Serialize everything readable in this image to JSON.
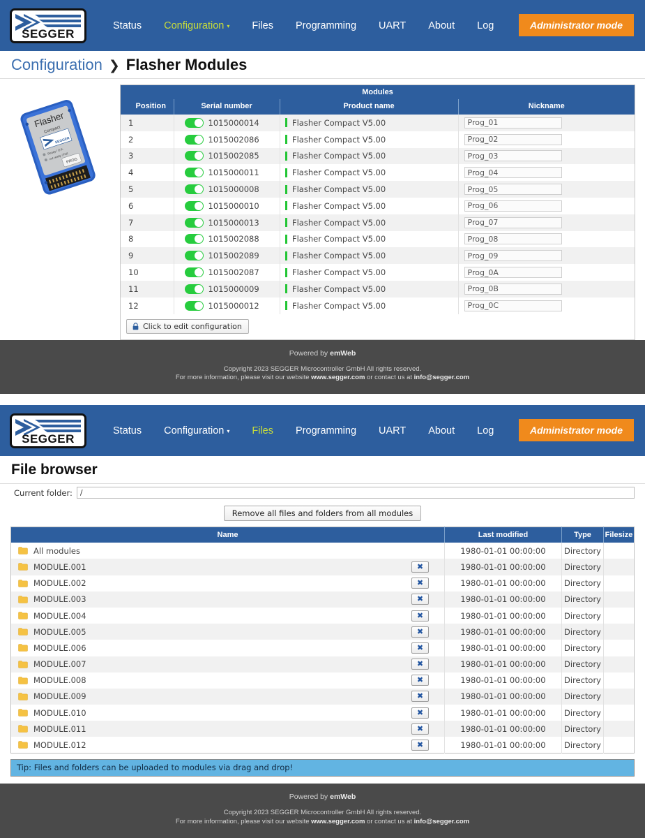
{
  "brand": {
    "logo_word": "SEGGER",
    "accent_blue": "#2d5e9e",
    "accent_orange": "#f08a1c",
    "accent_green": "#27cc3e",
    "nav_active_color": "#c8dd3a"
  },
  "section1": {
    "nav": {
      "items": [
        {
          "label": "Status",
          "active": false
        },
        {
          "label": "Configuration",
          "active": true,
          "caret": "▾"
        },
        {
          "label": "Files",
          "active": false
        },
        {
          "label": "Programming",
          "active": false
        },
        {
          "label": "UART",
          "active": false
        },
        {
          "label": "About",
          "active": false
        },
        {
          "label": "Log",
          "active": false
        }
      ],
      "admin_button": "Administrator mode"
    },
    "breadcrumb": {
      "parent": "Configuration",
      "separator": "❯",
      "current": "Flasher Modules"
    },
    "device_image": {
      "title": "Flasher",
      "subtitle": "Compact",
      "led1": "Ready / O.K.",
      "led2": "not ready / Fail",
      "button": "PROG"
    },
    "table": {
      "group_header": "Modules",
      "columns": [
        "Position",
        "Serial number",
        "Product name",
        "Nickname"
      ],
      "rows": [
        {
          "position": "1",
          "serial": "1015000014",
          "product": "Flasher Compact V5.00",
          "nickname": "Prog_01",
          "enabled": true
        },
        {
          "position": "2",
          "serial": "1015002086",
          "product": "Flasher Compact V5.00",
          "nickname": "Prog_02",
          "enabled": true
        },
        {
          "position": "3",
          "serial": "1015002085",
          "product": "Flasher Compact V5.00",
          "nickname": "Prog_03",
          "enabled": true
        },
        {
          "position": "4",
          "serial": "1015000011",
          "product": "Flasher Compact V5.00",
          "nickname": "Prog_04",
          "enabled": true
        },
        {
          "position": "5",
          "serial": "1015000008",
          "product": "Flasher Compact V5.00",
          "nickname": "Prog_05",
          "enabled": true
        },
        {
          "position": "6",
          "serial": "1015000010",
          "product": "Flasher Compact V5.00",
          "nickname": "Prog_06",
          "enabled": true
        },
        {
          "position": "7",
          "serial": "1015000013",
          "product": "Flasher Compact V5.00",
          "nickname": "Prog_07",
          "enabled": true
        },
        {
          "position": "8",
          "serial": "1015002088",
          "product": "Flasher Compact V5.00",
          "nickname": "Prog_08",
          "enabled": true
        },
        {
          "position": "9",
          "serial": "1015002089",
          "product": "Flasher Compact V5.00",
          "nickname": "Prog_09",
          "enabled": true
        },
        {
          "position": "10",
          "serial": "1015002087",
          "product": "Flasher Compact V5.00",
          "nickname": "Prog_0A",
          "enabled": true
        },
        {
          "position": "11",
          "serial": "1015000009",
          "product": "Flasher Compact V5.00",
          "nickname": "Prog_0B",
          "enabled": true
        },
        {
          "position": "12",
          "serial": "1015000012",
          "product": "Flasher Compact V5.00",
          "nickname": "Prog_0C",
          "enabled": true
        }
      ]
    },
    "edit_button": "Click to edit configuration"
  },
  "section2": {
    "nav": {
      "items": [
        {
          "label": "Status",
          "active": false
        },
        {
          "label": "Configuration",
          "active": false,
          "caret": "▾"
        },
        {
          "label": "Files",
          "active": true
        },
        {
          "label": "Programming",
          "active": false
        },
        {
          "label": "UART",
          "active": false
        },
        {
          "label": "About",
          "active": false
        },
        {
          "label": "Log",
          "active": false
        }
      ],
      "admin_button": "Administrator mode"
    },
    "page_title": "File browser",
    "current_folder_label": "Current folder:",
    "current_folder_value": "/",
    "remove_all_button": "Remove all files and folders from all modules",
    "table": {
      "columns": [
        "Name",
        "Last modified",
        "Type",
        "Filesize"
      ],
      "rows": [
        {
          "name": "All modules",
          "modified": "1980-01-01 00:00:00",
          "type": "Directory",
          "filesize": "",
          "removable": false
        },
        {
          "name": "MODULE.001",
          "modified": "1980-01-01 00:00:00",
          "type": "Directory",
          "filesize": "",
          "removable": true
        },
        {
          "name": "MODULE.002",
          "modified": "1980-01-01 00:00:00",
          "type": "Directory",
          "filesize": "",
          "removable": true
        },
        {
          "name": "MODULE.003",
          "modified": "1980-01-01 00:00:00",
          "type": "Directory",
          "filesize": "",
          "removable": true
        },
        {
          "name": "MODULE.004",
          "modified": "1980-01-01 00:00:00",
          "type": "Directory",
          "filesize": "",
          "removable": true
        },
        {
          "name": "MODULE.005",
          "modified": "1980-01-01 00:00:00",
          "type": "Directory",
          "filesize": "",
          "removable": true
        },
        {
          "name": "MODULE.006",
          "modified": "1980-01-01 00:00:00",
          "type": "Directory",
          "filesize": "",
          "removable": true
        },
        {
          "name": "MODULE.007",
          "modified": "1980-01-01 00:00:00",
          "type": "Directory",
          "filesize": "",
          "removable": true
        },
        {
          "name": "MODULE.008",
          "modified": "1980-01-01 00:00:00",
          "type": "Directory",
          "filesize": "",
          "removable": true
        },
        {
          "name": "MODULE.009",
          "modified": "1980-01-01 00:00:00",
          "type": "Directory",
          "filesize": "",
          "removable": true
        },
        {
          "name": "MODULE.010",
          "modified": "1980-01-01 00:00:00",
          "type": "Directory",
          "filesize": "",
          "removable": true
        },
        {
          "name": "MODULE.011",
          "modified": "1980-01-01 00:00:00",
          "type": "Directory",
          "filesize": "",
          "removable": true
        },
        {
          "name": "MODULE.012",
          "modified": "1980-01-01 00:00:00",
          "type": "Directory",
          "filesize": "",
          "removable": true
        }
      ]
    },
    "tip": "Tip: Files and folders can be uploaded to modules via drag and drop!",
    "remove_symbol": "✖"
  },
  "footer": {
    "powered_prefix": "Powered by ",
    "powered_brand": "emWeb",
    "copyright": "Copyright 2023 SEGGER Microcontroller GmbH All rights reserved.",
    "info_prefix": "For more information, please visit our website ",
    "website": "www.segger.com",
    "info_mid": " or contact us at ",
    "email": "info@segger.com"
  }
}
